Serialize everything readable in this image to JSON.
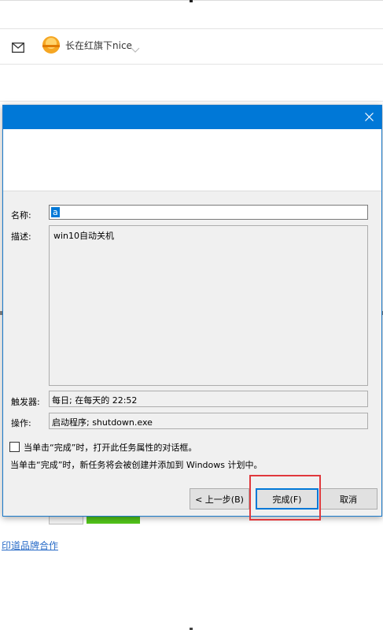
{
  "header": {
    "user_name": "长在红旗下nice",
    "mail_icon": "mail-icon",
    "user_icon": "user-avatar-icon"
  },
  "background": {
    "link_text": "印道品牌合作"
  },
  "dialog": {
    "title": "",
    "name_label": "名称:",
    "name_value": "a",
    "desc_label": "描述:",
    "desc_value": "win10自动关机",
    "trigger_label": "触发器:",
    "trigger_value": "每日; 在每天的 22:52",
    "action_label": "操作:",
    "action_value": "启动程序; shutdown.exe",
    "checkbox_label": "当单击“完成”时，打开此任务属性的对话框。",
    "checkbox_checked": false,
    "info_text": "当单击“完成”时，新任务将会被创建并添加到 Windows 计划中。",
    "back_button": "< 上一步(B)",
    "finish_button": "完成(F)",
    "cancel_button": "取消"
  },
  "colors": {
    "titlebar": "#0078d7",
    "highlight": "#e0383c"
  }
}
